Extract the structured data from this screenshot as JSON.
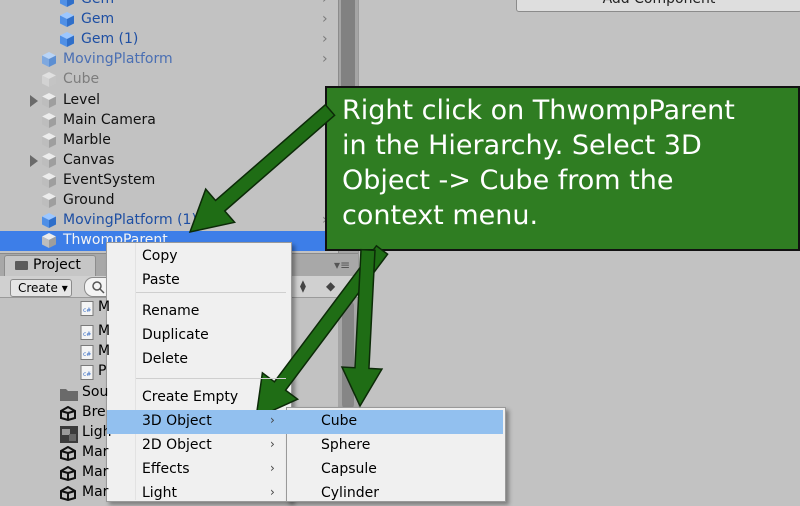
{
  "hierarchy": {
    "items": [
      {
        "label": "Gem",
        "color": "#1e4fa3",
        "cube": "blue",
        "indent": 2,
        "chevron": true
      },
      {
        "label": "Gem",
        "color": "#1e4fa3",
        "cube": "blue",
        "indent": 2,
        "chevron": true
      },
      {
        "label": "Gem (1)",
        "color": "#1e4fa3",
        "cube": "blue",
        "indent": 2,
        "chevron": true
      },
      {
        "label": "MovingPlatform",
        "color": "#4a6fb3",
        "cube": "lightblue",
        "indent": 1,
        "chevron": true
      },
      {
        "label": "Cube",
        "color": "#7d7d7d",
        "cube": "faded",
        "indent": 1,
        "chevron": false
      },
      {
        "label": "Level",
        "color": "#111111",
        "cube": "grey",
        "indent": 1,
        "chevron": false,
        "expandable": true
      },
      {
        "label": "Main Camera",
        "color": "#111111",
        "cube": "grey",
        "indent": 1,
        "chevron": false
      },
      {
        "label": "Marble",
        "color": "#111111",
        "cube": "grey",
        "indent": 1,
        "chevron": false
      },
      {
        "label": "Canvas",
        "color": "#111111",
        "cube": "grey",
        "indent": 1,
        "chevron": false,
        "expandable": true
      },
      {
        "label": "EventSystem",
        "color": "#111111",
        "cube": "grey",
        "indent": 1,
        "chevron": false
      },
      {
        "label": "Ground",
        "color": "#111111",
        "cube": "grey",
        "indent": 1,
        "chevron": false
      },
      {
        "label": "MovingPlatform (1)",
        "color": "#1e4fa3",
        "cube": "blue",
        "indent": 1,
        "chevron": true
      },
      {
        "label": "ThwompParent",
        "color": "#f4f4f4",
        "cube": "grey",
        "indent": 1,
        "chevron": false,
        "selected": true
      }
    ]
  },
  "inspector": {
    "add_component_label": "Add Component"
  },
  "project": {
    "tab_label": "Project",
    "create_label": "Create ▾",
    "search_icon": "search-icon",
    "items": [
      {
        "label": "M",
        "icon": "script"
      },
      {
        "label": "M",
        "icon": "script"
      },
      {
        "label": "M",
        "icon": "script"
      },
      {
        "label": "P",
        "icon": "script"
      },
      {
        "label": "Sou",
        "icon": "folder"
      },
      {
        "label": "Bre",
        "icon": "unity"
      },
      {
        "label": "Ligh",
        "icon": "image"
      },
      {
        "label": "Mar",
        "icon": "unity"
      },
      {
        "label": "Mar",
        "icon": "unity"
      },
      {
        "label": "Mar",
        "icon": "unity"
      }
    ]
  },
  "context_menu": {
    "items": [
      {
        "label": "Copy"
      },
      {
        "label": "Paste"
      },
      {
        "label": "Rename"
      },
      {
        "label": "Duplicate"
      },
      {
        "label": "Delete"
      },
      {
        "label": "Create Empty"
      },
      {
        "label": "3D Object",
        "submenu": true,
        "highlighted": true
      },
      {
        "label": "2D Object",
        "submenu": true
      },
      {
        "label": "Effects",
        "submenu": true
      },
      {
        "label": "Light",
        "submenu": true
      }
    ]
  },
  "submenu": {
    "items": [
      {
        "label": "Cube",
        "highlighted": true
      },
      {
        "label": "Sphere"
      },
      {
        "label": "Capsule"
      },
      {
        "label": "Cylinder"
      }
    ]
  },
  "callout": {
    "text": "Right click on ThwompParent in the Hierarchy.  Select 3D Object -> Cube from the context menu.",
    "lines": [
      "Right click on ThwompParent",
      "in the Hierarchy.  Select 3D",
      "Object -> Cube from the",
      "context menu."
    ],
    "background": "#2f7d22"
  },
  "colors": {
    "selection": "#3d7ee8",
    "menu_highlight": "#92c0ef",
    "arrow_fill": "#1f6d15"
  }
}
